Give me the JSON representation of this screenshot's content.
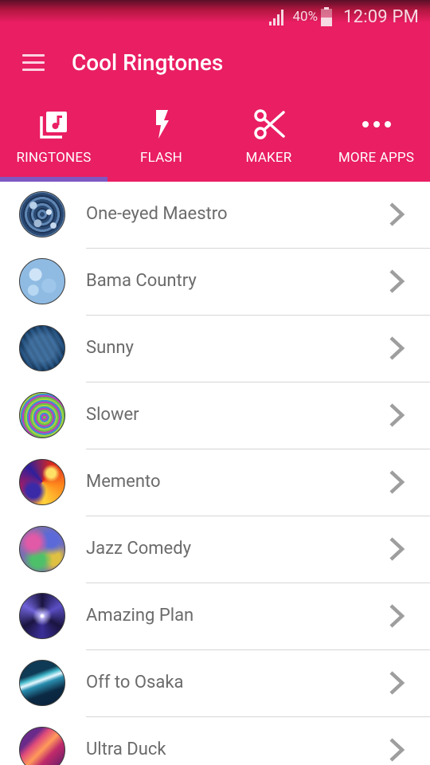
{
  "status_bar": {
    "battery_percent": "40%",
    "time": "12:09 PM"
  },
  "app_bar": {
    "title": "Cool Ringtones",
    "menu_icon": "hamburger-menu-icon"
  },
  "tabs": [
    {
      "label": "RINGTONES",
      "icon": "music-library-icon",
      "selected": true
    },
    {
      "label": "FLASH",
      "icon": "flash-icon",
      "selected": false
    },
    {
      "label": "MAKER",
      "icon": "scissors-icon",
      "selected": false
    },
    {
      "label": "MORE APPS",
      "icon": "more-dots-icon",
      "selected": false
    }
  ],
  "colors": {
    "primary": "#e91e63",
    "tab_indicator": "#7e57c2",
    "list_text": "#6b6b6b",
    "chevron": "#9e9e9e",
    "divider": "#d6d6d6"
  },
  "ringtones": [
    {
      "title": "One-eyed Maestro"
    },
    {
      "title": "Bama Country"
    },
    {
      "title": "Sunny"
    },
    {
      "title": "Slower"
    },
    {
      "title": "Memento"
    },
    {
      "title": "Jazz Comedy"
    },
    {
      "title": "Amazing Plan"
    },
    {
      "title": "Off to Osaka"
    },
    {
      "title": "Ultra Duck"
    }
  ]
}
